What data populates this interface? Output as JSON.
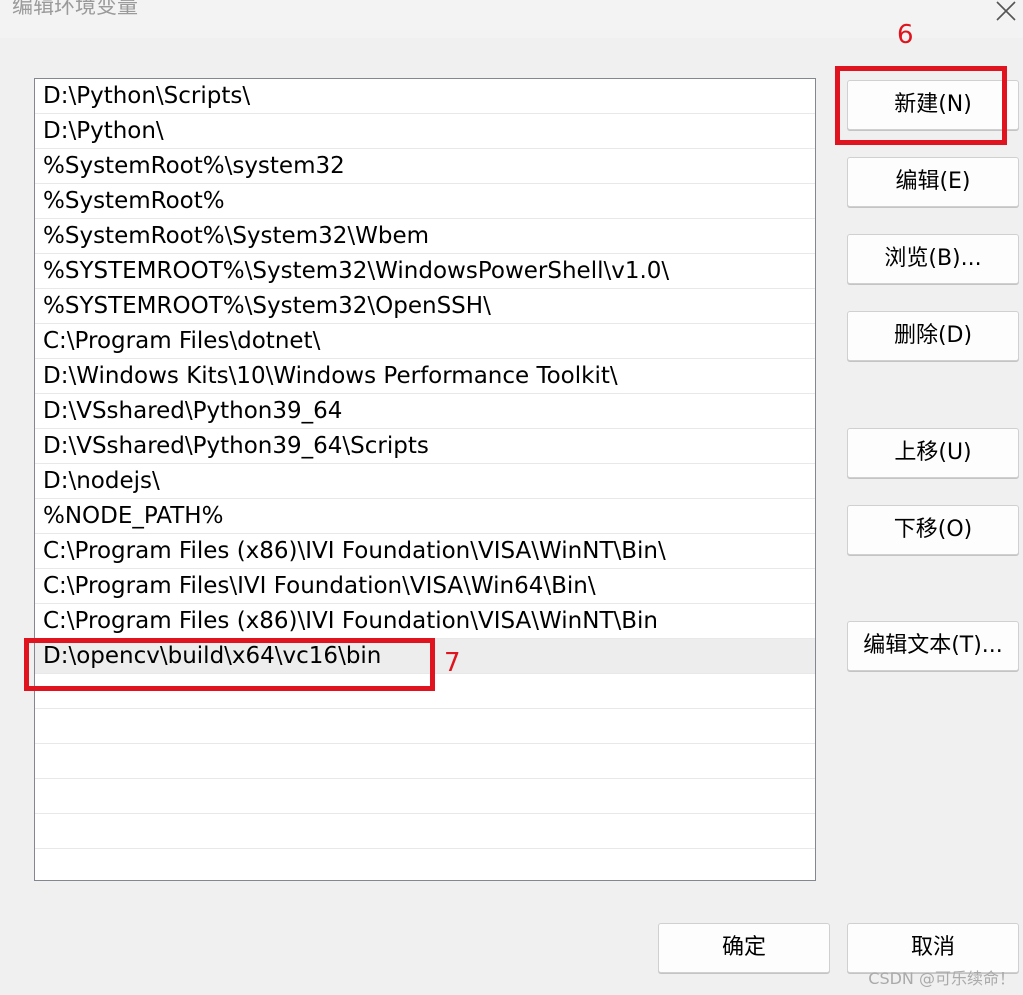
{
  "window": {
    "title": "编辑环境变量",
    "close_icon": "close-icon"
  },
  "path_list": {
    "items": [
      "D:\\Python\\Scripts\\",
      "D:\\Python\\",
      "%SystemRoot%\\system32",
      "%SystemRoot%",
      "%SystemRoot%\\System32\\Wbem",
      "%SYSTEMROOT%\\System32\\WindowsPowerShell\\v1.0\\",
      "%SYSTEMROOT%\\System32\\OpenSSH\\",
      "C:\\Program Files\\dotnet\\",
      "D:\\Windows Kits\\10\\Windows Performance Toolkit\\",
      "D:\\VSshared\\Python39_64",
      "D:\\VSshared\\Python39_64\\Scripts",
      "D:\\nodejs\\",
      "%NODE_PATH%",
      "C:\\Program Files (x86)\\IVI Foundation\\VISA\\WinNT\\Bin\\",
      "C:\\Program Files\\IVI Foundation\\VISA\\Win64\\Bin\\",
      "C:\\Program Files (x86)\\IVI Foundation\\VISA\\WinNT\\Bin",
      "D:\\opencv\\build\\x64\\vc16\\bin",
      "",
      "",
      "",
      "",
      "",
      "",
      ""
    ],
    "selected_index": 16
  },
  "buttons": {
    "new": "新建(N)",
    "edit": "编辑(E)",
    "browse": "浏览(B)...",
    "delete": "删除(D)",
    "move_up": "上移(U)",
    "move_down": "下移(O)",
    "edit_text": "编辑文本(T)...",
    "ok": "确定",
    "cancel": "取消"
  },
  "annotations": {
    "step_new": "6",
    "step_entry": "7",
    "color": "#e0141e"
  },
  "watermark": "CSDN @可乐续命！"
}
